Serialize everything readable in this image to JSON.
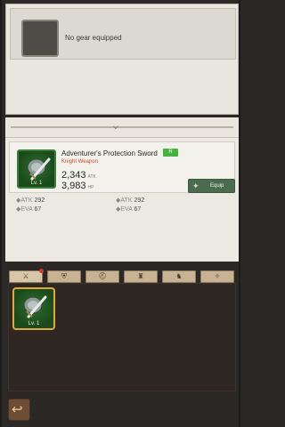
{
  "equipped": {
    "empty_text": "No gear equipped"
  },
  "selected_item": {
    "name": "Adventurer's Protection Sword",
    "grade": "R",
    "type": "Knight Weapon",
    "level": "Lv. 1",
    "atk_value": "2,343",
    "atk_unit": "ATK",
    "hp_value": "3,983",
    "hp_unit": "HP",
    "equip_label": "Equip",
    "stats_left": [
      {
        "key": "ATK",
        "value": "292"
      },
      {
        "key": "EVA",
        "value": "67"
      }
    ],
    "stats_right": [
      {
        "key": "ATK",
        "value": "292"
      },
      {
        "key": "EVA",
        "value": "67"
      }
    ]
  },
  "tabs": [
    {
      "icon": "sword-icon",
      "glyph": "⚔"
    },
    {
      "icon": "shield-icon",
      "glyph": "⛨"
    },
    {
      "icon": "helmet-icon",
      "glyph": "⛑"
    },
    {
      "icon": "armor-icon",
      "glyph": "♜"
    },
    {
      "icon": "boots-icon",
      "glyph": "♞"
    },
    {
      "icon": "accessory-icon",
      "glyph": "✧"
    }
  ],
  "inventory": [
    {
      "name": "Adventurer's Protection Sword",
      "level": "Lv. 1"
    }
  ],
  "colors": {
    "accent_green": "#45b33e",
    "weapon_type_red": "#c94a2d",
    "selected_border": "#e0a93b"
  }
}
